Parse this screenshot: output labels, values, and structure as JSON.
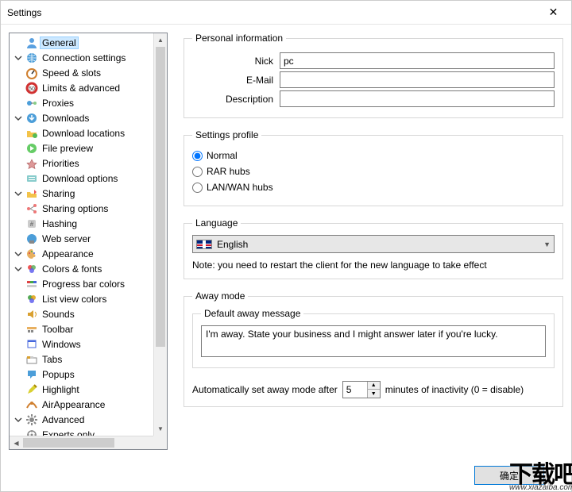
{
  "window": {
    "title": "Settings",
    "close": "✕"
  },
  "tree": {
    "general": "General",
    "connection": "Connection settings",
    "speed": "Speed & slots",
    "limits": "Limits & advanced",
    "proxies": "Proxies",
    "downloads": "Downloads",
    "dl_locations": "Download locations",
    "file_preview": "File preview",
    "priorities": "Priorities",
    "dl_options": "Download options",
    "sharing": "Sharing",
    "sharing_options": "Sharing options",
    "hashing": "Hashing",
    "web_server": "Web server",
    "appearance": "Appearance",
    "colors_fonts": "Colors & fonts",
    "progress_bar_colors": "Progress bar colors",
    "list_view_colors": "List view colors",
    "sounds": "Sounds",
    "toolbar": "Toolbar",
    "windows": "Windows",
    "tabs": "Tabs",
    "popups": "Popups",
    "highlight": "Highlight",
    "air_appearance": "AirAppearance",
    "advanced": "Advanced",
    "experts_only": "Experts only"
  },
  "personal": {
    "legend": "Personal information",
    "nick_label": "Nick",
    "nick_value": "pc",
    "email_label": "E-Mail",
    "email_value": "",
    "desc_label": "Description",
    "desc_value": ""
  },
  "profile": {
    "legend": "Settings profile",
    "normal": "Normal",
    "rar": "RAR hubs",
    "lanwan": "LAN/WAN hubs",
    "selected": "normal"
  },
  "language": {
    "legend": "Language",
    "value": "English",
    "note": "Note: you need to restart the client for the new language to take effect"
  },
  "away": {
    "legend": "Away mode",
    "sub_legend": "Default away message",
    "message": "I'm away. State your business and I might answer later if you're lucky.",
    "auto_before": "Automatically set away mode after",
    "auto_value": "5",
    "auto_after": "minutes of inactivity (0 = disable)"
  },
  "buttons": {
    "ok": "确定",
    "cancel": ""
  },
  "watermark": {
    "big": "下载吧",
    "small": "www.xiazaiba.com"
  }
}
